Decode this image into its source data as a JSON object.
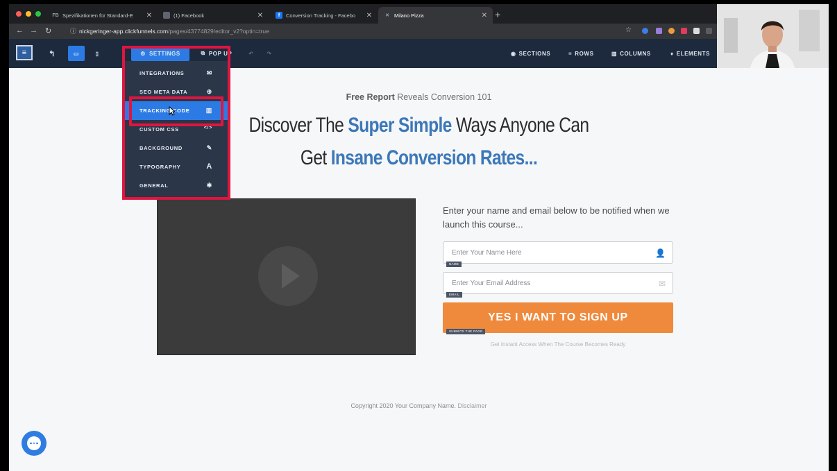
{
  "browser": {
    "tabs": [
      {
        "label": "Spezifikationen für Standard-E",
        "favicon": "FB"
      },
      {
        "label": "(1) Facebook",
        "favicon": ""
      },
      {
        "label": "Conversion Tracking - Facebo",
        "favicon": "f"
      },
      {
        "label": "Milano Pizza",
        "favicon": ""
      }
    ],
    "url_host": "nickgeringer-app.clickfunnels.com",
    "url_path": "/pages/43774829/editor_v2?optin=true"
  },
  "toolbar": {
    "settings_label": "SETTINGS",
    "popup_label": "POP UP",
    "sections_label": "SECTIONS",
    "rows_label": "ROWS",
    "columns_label": "COLUMNS",
    "elements_label": "ELEMENTS"
  },
  "settings_menu": {
    "items": [
      {
        "label": "INTEGRATIONS",
        "icon": "envelope-icon",
        "glyph": "✉"
      },
      {
        "label": "SEO META DATA",
        "icon": "globe-icon",
        "glyph": "⊕"
      },
      {
        "label": "TRACKING CODE",
        "icon": "chart-icon",
        "glyph": "▥"
      },
      {
        "label": "CUSTOM CSS",
        "icon": "code-icon",
        "glyph": "</>"
      },
      {
        "label": "BACKGROUND",
        "icon": "brush-icon",
        "glyph": "✎"
      },
      {
        "label": "TYPOGRAPHY",
        "icon": "font-icon",
        "glyph": "A"
      },
      {
        "label": "GENERAL",
        "icon": "gear-icon",
        "glyph": "✱"
      }
    ],
    "active_item": "TRACKING CODE"
  },
  "page": {
    "free_report_bold": "Free Report",
    "free_report_rest": "Reveals Conversion 101",
    "headline1_a": "Discover The ",
    "headline1_b": "Super Simple",
    "headline1_c": " Ways Anyone Can",
    "headline2_a": "Get ",
    "headline2_b": "Insane Conversion Rates...",
    "form_intro": "Enter your name and email below to be notified when we launch this course...",
    "name_placeholder": "Enter Your Name Here",
    "name_tag": "NAME",
    "email_placeholder": "Enter Your Email Address",
    "email_tag": "EMAIL",
    "cta_label": "YES I WANT TO SIGN UP",
    "cta_tag": "SUBMITS THE PAGE",
    "cta_note": "Get Instant Access When The Course Becomes Ready",
    "copyright": "Copyright 2020 Your Company Name.",
    "disclaimer": "Disclaimer"
  },
  "colors": {
    "accent_blue": "#2c7be5",
    "headline_blue": "#3c78b8",
    "cta_orange": "#ef8a3d",
    "highlight_red": "#e0153f"
  }
}
